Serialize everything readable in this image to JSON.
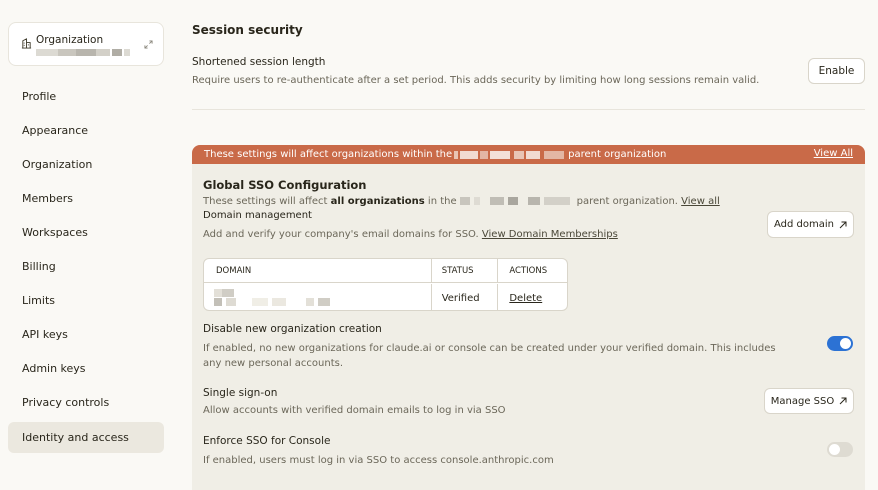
{
  "sidebar": {
    "org_label": "Organization",
    "items": [
      {
        "label": "Profile"
      },
      {
        "label": "Appearance"
      },
      {
        "label": "Organization"
      },
      {
        "label": "Members"
      },
      {
        "label": "Workspaces"
      },
      {
        "label": "Billing"
      },
      {
        "label": "Limits"
      },
      {
        "label": "API keys"
      },
      {
        "label": "Admin keys"
      },
      {
        "label": "Privacy controls"
      },
      {
        "label": "Identity and access",
        "active": true
      }
    ]
  },
  "session": {
    "heading": "Session security",
    "title": "Shortened session length",
    "description": "Require users to re-authenticate after a set period. This adds security by limiting how long sessions remain valid.",
    "enable_label": "Enable"
  },
  "banner": {
    "prefix": "These settings will affect organizations within the",
    "suffix": "parent organization",
    "view_all": "View All",
    "color": "#c96a48"
  },
  "sso": {
    "title": "Global SSO Configuration",
    "desc_prefix": "These settings will affect",
    "desc_bold": "all organizations",
    "desc_mid": "in the",
    "desc_suffix": "parent organization.",
    "view_all": "View all"
  },
  "domain": {
    "title": "Domain management",
    "desc": "Add and verify your company's email domains for SSO.",
    "link": "View Domain Memberships",
    "add_label": "Add domain",
    "table": {
      "headers": [
        "DOMAIN",
        "STATUS",
        "ACTIONS"
      ],
      "rows": [
        {
          "status": "Verified",
          "action": "Delete"
        }
      ]
    }
  },
  "options": [
    {
      "title": "Disable new organization creation",
      "desc": "If enabled, no new organizations for claude.ai or console can be created under your verified domain. This includes any new personal accounts.",
      "enabled": true
    },
    {
      "title": "Single sign-on",
      "desc": "Allow accounts with verified domain emails to log in via SSO",
      "button": "Manage SSO"
    },
    {
      "title": "Enforce SSO for Console",
      "desc": "If enabled, users must log in via SSO to access console.anthropic.com",
      "enabled": false
    }
  ],
  "colors": {
    "accent": "#2c72d4",
    "background": "#faf9f5",
    "panel": "#f0eee6"
  }
}
